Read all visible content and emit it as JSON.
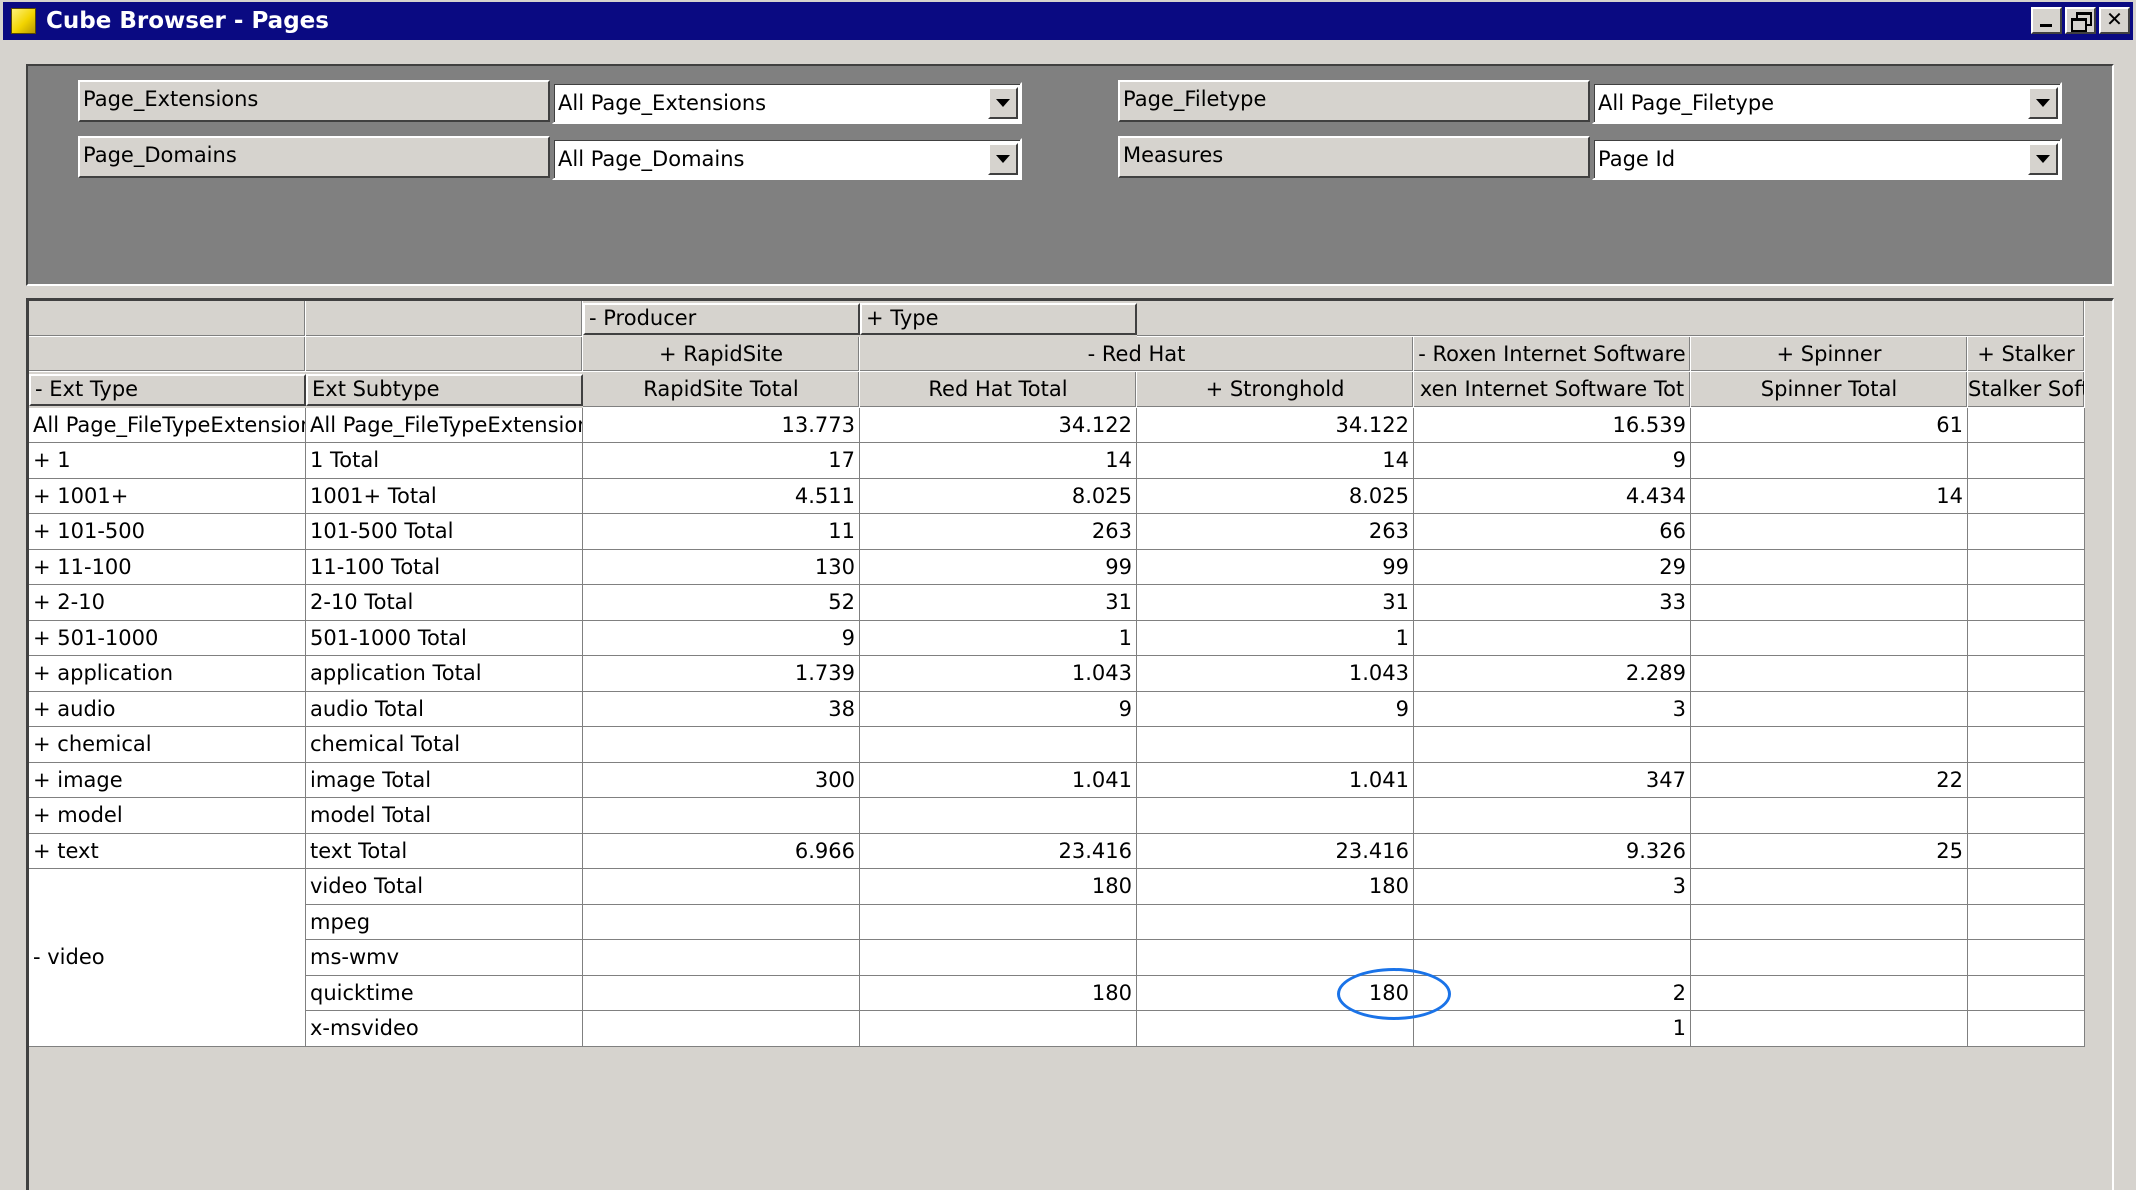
{
  "window": {
    "title": "Cube Browser - Pages"
  },
  "filters": {
    "page_extensions": {
      "label": "Page_Extensions",
      "value": "All Page_Extensions"
    },
    "page_domains": {
      "label": "Page_Domains",
      "value": "All Page_Domains"
    },
    "page_filetype": {
      "label": "Page_Filetype",
      "value": "All Page_Filetype"
    },
    "measures": {
      "label": "Measures",
      "value": "Page Id"
    }
  },
  "pivot": {
    "column_fields": {
      "producer": "- Producer",
      "type": "+ Type"
    },
    "row_fields": {
      "ext_type": "- Ext Type",
      "ext_subtype": "Ext Subtype"
    },
    "producer_headers": [
      "+ RapidSite",
      "- Red Hat",
      "- Roxen Internet Software",
      "+ Spinner",
      "+ Stalker"
    ],
    "column_headers": [
      "RapidSite Total",
      "Red Hat Total",
      "+ Stronghold",
      "xen Internet Software Tot",
      "Spinner Total",
      "Stalker Soft"
    ],
    "rows": [
      {
        "type": "All Page_FileTypeExtension",
        "subtype": "All Page_FileTypeExtension",
        "values": [
          "13.773",
          "34.122",
          "34.122",
          "16.539",
          "61",
          ""
        ]
      },
      {
        "type": "+ 1",
        "subtype": "1 Total",
        "values": [
          "17",
          "14",
          "14",
          "9",
          "",
          ""
        ]
      },
      {
        "type": "+ 1001+",
        "subtype": "1001+ Total",
        "values": [
          "4.511",
          "8.025",
          "8.025",
          "4.434",
          "14",
          ""
        ]
      },
      {
        "type": "+ 101-500",
        "subtype": "101-500 Total",
        "values": [
          "11",
          "263",
          "263",
          "66",
          "",
          ""
        ]
      },
      {
        "type": "+ 11-100",
        "subtype": "11-100 Total",
        "values": [
          "130",
          "99",
          "99",
          "29",
          "",
          ""
        ]
      },
      {
        "type": "+ 2-10",
        "subtype": "2-10 Total",
        "values": [
          "52",
          "31",
          "31",
          "33",
          "",
          ""
        ]
      },
      {
        "type": "+ 501-1000",
        "subtype": "501-1000 Total",
        "values": [
          "9",
          "1",
          "1",
          "",
          "",
          ""
        ]
      },
      {
        "type": "+ application",
        "subtype": "application Total",
        "values": [
          "1.739",
          "1.043",
          "1.043",
          "2.289",
          "",
          ""
        ]
      },
      {
        "type": "+ audio",
        "subtype": "audio Total",
        "values": [
          "38",
          "9",
          "9",
          "3",
          "",
          ""
        ]
      },
      {
        "type": "+ chemical",
        "subtype": "chemical Total",
        "values": [
          "",
          "",
          "",
          "",
          "",
          ""
        ]
      },
      {
        "type": "+ image",
        "subtype": "image Total",
        "values": [
          "300",
          "1.041",
          "1.041",
          "347",
          "22",
          ""
        ]
      },
      {
        "type": "+ model",
        "subtype": "model Total",
        "values": [
          "",
          "",
          "",
          "",
          "",
          ""
        ]
      },
      {
        "type": "+ text",
        "subtype": "text Total",
        "values": [
          "6.966",
          "23.416",
          "23.416",
          "9.326",
          "25",
          ""
        ]
      },
      {
        "type": "",
        "subtype": "video Total",
        "values": [
          "",
          "180",
          "180",
          "3",
          "",
          ""
        ]
      },
      {
        "type": "",
        "subtype": "mpeg",
        "values": [
          "",
          "",
          "",
          "",
          "",
          ""
        ]
      },
      {
        "type": "",
        "subtype": "ms-wmv",
        "values": [
          "",
          "",
          "",
          "",
          "",
          ""
        ]
      },
      {
        "type": "",
        "subtype": "quicktime",
        "values": [
          "",
          "180",
          "180",
          "2",
          "",
          ""
        ]
      },
      {
        "type": "",
        "subtype": "x-msvideo",
        "values": [
          "",
          "",
          "",
          "1",
          "",
          ""
        ]
      }
    ],
    "video_group_label": "- video"
  },
  "colors": {
    "titlebar": "#0a0a82",
    "highlight": "#1a73e8"
  }
}
